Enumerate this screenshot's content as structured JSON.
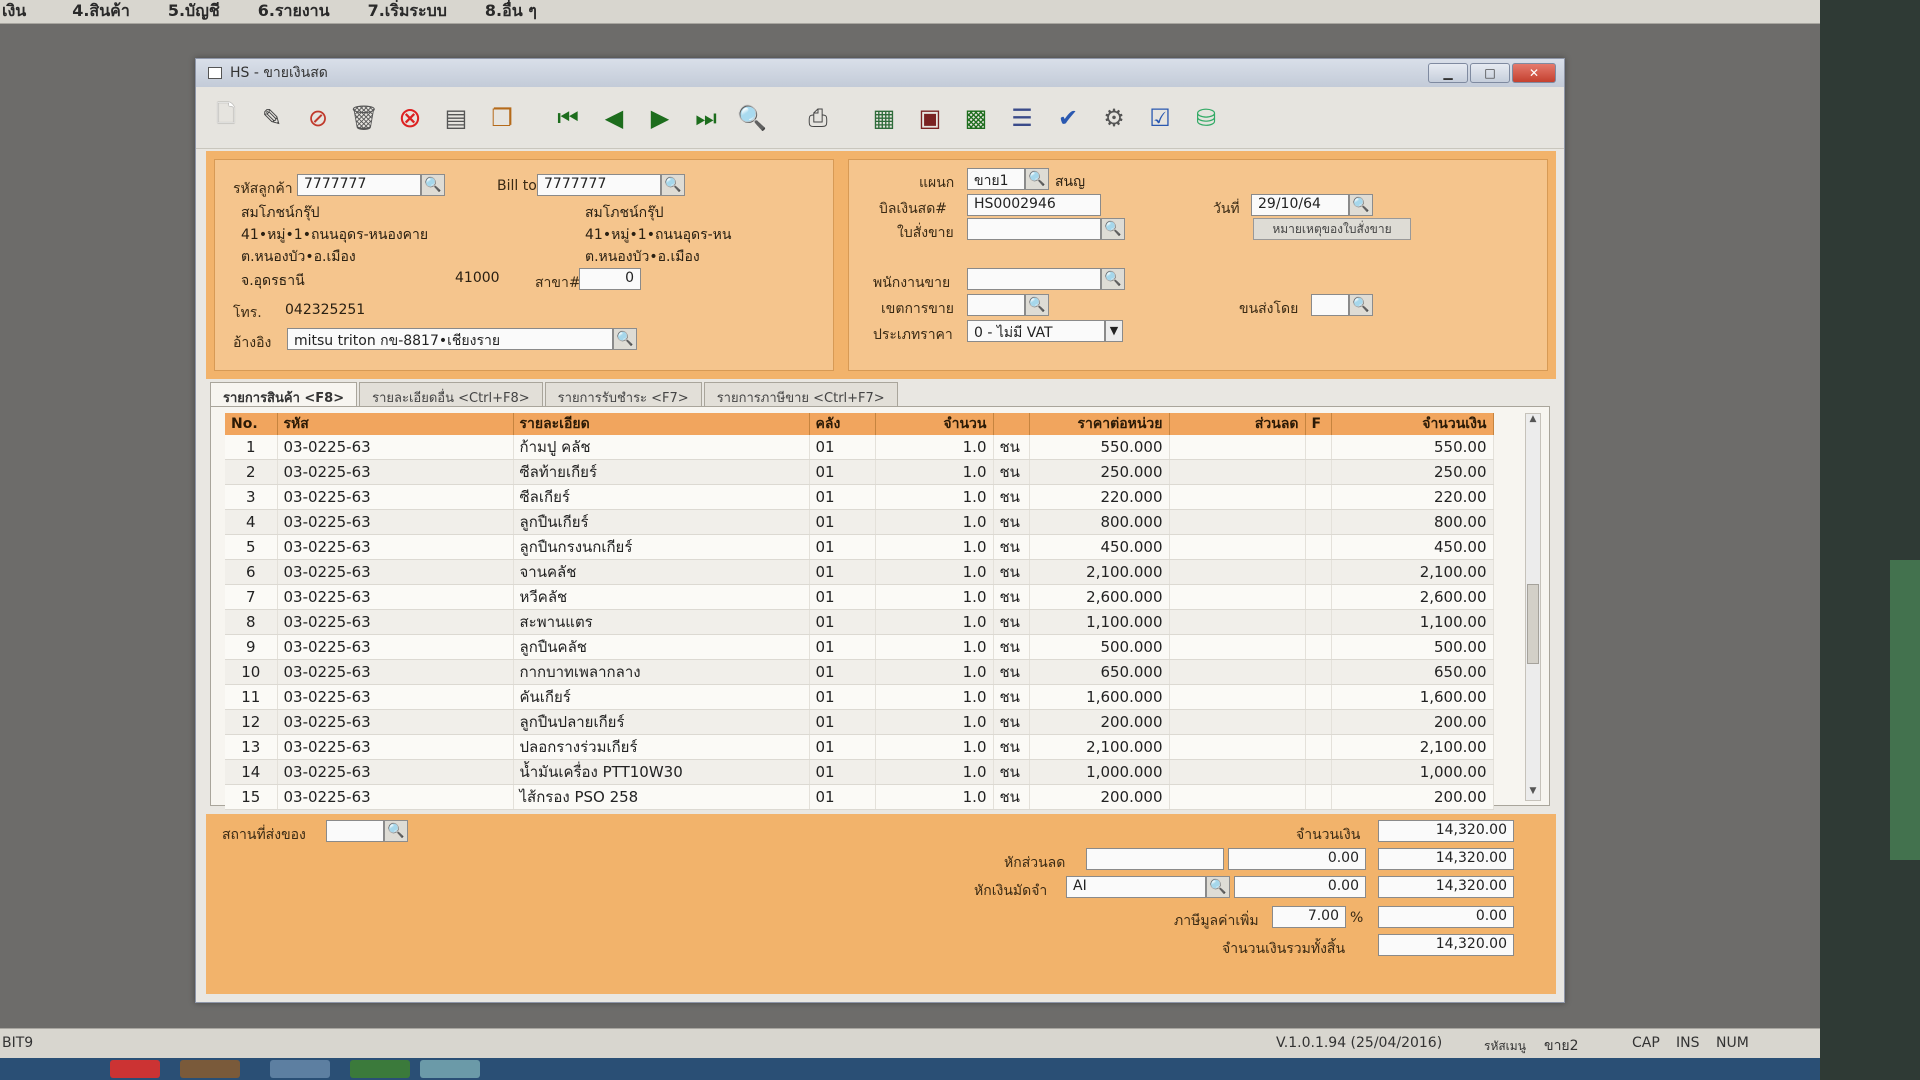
{
  "menu": [
    "เงิน",
    "4.สินค้า",
    "5.บัญชี",
    "6.รายงาน",
    "7.เริ่มระบบ",
    "8.อื่น ๆ"
  ],
  "window": {
    "title": "HS - ขายเงินสด",
    "min_label": "▁",
    "max_label": "□",
    "close_label": "✕"
  },
  "customer": {
    "code_label": "รหัสลูกค้า",
    "code": "7777777",
    "bill_to_label": "Bill to",
    "bill_to": "7777777",
    "name": "สมโภชน์กรุ๊ป",
    "addr1": "41•หมู่•1•ถนนอุดร-หนองคาย",
    "addr2": "ต.หนองบัว•อ.เมือง",
    "province": "จ.อุดรธานี",
    "postcode": "41000",
    "bill_name": "สมโภชน์กรุ๊ป",
    "bill_addr1": "41•หมู่•1•ถนนอุดร-หน",
    "bill_addr2": "ต.หนองบัว•อ.เมือง",
    "branch_label": "สาขา#",
    "branch": "0",
    "phone_label": "โทร.",
    "phone": "042325251",
    "ref_label": "อ้างอิง",
    "ref": "mitsu triton กข-8817•เชียงราย"
  },
  "doc": {
    "dept_label": "แผนก",
    "dept": "ขาย1",
    "dept_name": "สนญ",
    "bill_no_label": "บิลเงินสด#",
    "bill_no": "HS0002946",
    "date_label": "วันที่",
    "date": "29/10/64",
    "so_label": "ใบสั่งขาย",
    "so": "",
    "so_note_button": "หมายเหตุของใบสั่งขาย",
    "salesman_label": "พนักงานขาย",
    "salesman": "",
    "area_label": "เขตการขาย",
    "area": "",
    "ship_by_label": "ขนส่งโดย",
    "ship_by": "",
    "price_type_label": "ประเภทราคา",
    "price_type": "0 - ไม่มี VAT"
  },
  "tabs": [
    "รายการสินค้า <F8>",
    "รายละเอียดอื่น <Ctrl+F8>",
    "รายการรับชำระ <F7>",
    "รายการภาษีขาย <Ctrl+F7>"
  ],
  "grid": {
    "columns": [
      "No.",
      "รหัส",
      "รายละเอียด",
      "คลัง",
      "จำนวน",
      "",
      "ราคาต่อหน่วย",
      "ส่วนลด",
      "F",
      "จำนวนเงิน"
    ],
    "rows": [
      {
        "no": "1",
        "code": "03-0225-63",
        "desc": "ก้ามปู คลัช",
        "wh": "01",
        "qty": "1.0",
        "unit": "ชน",
        "price": "550.000",
        "disc": "",
        "f": "",
        "amount": "550.00"
      },
      {
        "no": "2",
        "code": "03-0225-63",
        "desc": "ซีลท้ายเกียร์",
        "wh": "01",
        "qty": "1.0",
        "unit": "ชน",
        "price": "250.000",
        "disc": "",
        "f": "",
        "amount": "250.00"
      },
      {
        "no": "3",
        "code": "03-0225-63",
        "desc": "ซีลเกียร์",
        "wh": "01",
        "qty": "1.0",
        "unit": "ชน",
        "price": "220.000",
        "disc": "",
        "f": "",
        "amount": "220.00"
      },
      {
        "no": "4",
        "code": "03-0225-63",
        "desc": "ลูกปืนเกียร์",
        "wh": "01",
        "qty": "1.0",
        "unit": "ชน",
        "price": "800.000",
        "disc": "",
        "f": "",
        "amount": "800.00"
      },
      {
        "no": "5",
        "code": "03-0225-63",
        "desc": "ลูกปืนกรงนกเกียร์",
        "wh": "01",
        "qty": "1.0",
        "unit": "ชน",
        "price": "450.000",
        "disc": "",
        "f": "",
        "amount": "450.00"
      },
      {
        "no": "6",
        "code": "03-0225-63",
        "desc": "จานคลัช",
        "wh": "01",
        "qty": "1.0",
        "unit": "ชน",
        "price": "2,100.000",
        "disc": "",
        "f": "",
        "amount": "2,100.00"
      },
      {
        "no": "7",
        "code": "03-0225-63",
        "desc": "หวีคลัช",
        "wh": "01",
        "qty": "1.0",
        "unit": "ชน",
        "price": "2,600.000",
        "disc": "",
        "f": "",
        "amount": "2,600.00"
      },
      {
        "no": "8",
        "code": "03-0225-63",
        "desc": "สะพานแตร",
        "wh": "01",
        "qty": "1.0",
        "unit": "ชน",
        "price": "1,100.000",
        "disc": "",
        "f": "",
        "amount": "1,100.00"
      },
      {
        "no": "9",
        "code": "03-0225-63",
        "desc": "ลูกปืนคลัช",
        "wh": "01",
        "qty": "1.0",
        "unit": "ชน",
        "price": "500.000",
        "disc": "",
        "f": "",
        "amount": "500.00"
      },
      {
        "no": "10",
        "code": "03-0225-63",
        "desc": "กากบาทเพลากลาง",
        "wh": "01",
        "qty": "1.0",
        "unit": "ชน",
        "price": "650.000",
        "disc": "",
        "f": "",
        "amount": "650.00"
      },
      {
        "no": "11",
        "code": "03-0225-63",
        "desc": "คันเกียร์",
        "wh": "01",
        "qty": "1.0",
        "unit": "ชน",
        "price": "1,600.000",
        "disc": "",
        "f": "",
        "amount": "1,600.00"
      },
      {
        "no": "12",
        "code": "03-0225-63",
        "desc": "ลูกปืนปลายเกียร์",
        "wh": "01",
        "qty": "1.0",
        "unit": "ชน",
        "price": "200.000",
        "disc": "",
        "f": "",
        "amount": "200.00"
      },
      {
        "no": "13",
        "code": "03-0225-63",
        "desc": "ปลอกรางร่วมเกียร์",
        "wh": "01",
        "qty": "1.0",
        "unit": "ชน",
        "price": "2,100.000",
        "disc": "",
        "f": "",
        "amount": "2,100.00"
      },
      {
        "no": "14",
        "code": "03-0225-63",
        "desc": "น้ำมันเครื่อง PTT10W30",
        "wh": "01",
        "qty": "1.0",
        "unit": "ชน",
        "price": "1,000.000",
        "disc": "",
        "f": "",
        "amount": "1,000.00"
      },
      {
        "no": "15",
        "code": "03-0225-63",
        "desc": "ไส้กรอง PSO 258",
        "wh": "01",
        "qty": "1.0",
        "unit": "ชน",
        "price": "200.000",
        "disc": "",
        "f": "",
        "amount": "200.00"
      }
    ]
  },
  "summary": {
    "ship_place_label": "สถานที่ส่งของ",
    "ship_place": "",
    "amount_label": "จำนวนเงิน",
    "amount": "14,320.00",
    "discount_label": "หักส่วนลด",
    "discount_text": "",
    "discount": "0.00",
    "after_discount": "14,320.00",
    "deposit_label": "หักเงินมัดจำ",
    "deposit_code": "AI",
    "deposit": "0.00",
    "after_deposit": "14,320.00",
    "vat_label": "ภาษีมูลค่าเพิ่ม",
    "vat_rate": "7.00",
    "vat_pct": "%",
    "vat": "0.00",
    "total_label": "จำนวนเงินรวมทั้งสิ้น",
    "total": "14,320.00"
  },
  "status": {
    "left": "BIT9",
    "version": "V.1.0.1.94 (25/04/2016)",
    "user_label": "รหัสเมนู",
    "user": "ขาย2",
    "cap": "CAP",
    "ins": "INS",
    "num": "NUM"
  },
  "icons": {
    "new": "new-document-icon",
    "edit": "edit-icon",
    "cancel": "cancel-doc-icon",
    "delete": "trash-icon",
    "close": "close-red-icon",
    "save": "save-icon",
    "copy": "copy-icon",
    "first": "first-record-icon",
    "prev": "prev-record-icon",
    "next": "next-record-icon",
    "last": "last-record-icon",
    "search": "search-doc-icon",
    "print": "printer-icon"
  },
  "colors": {
    "header_bg": "#f2b36b",
    "panel_bg": "#f5c58d",
    "grid_header": "#f1a55e"
  }
}
